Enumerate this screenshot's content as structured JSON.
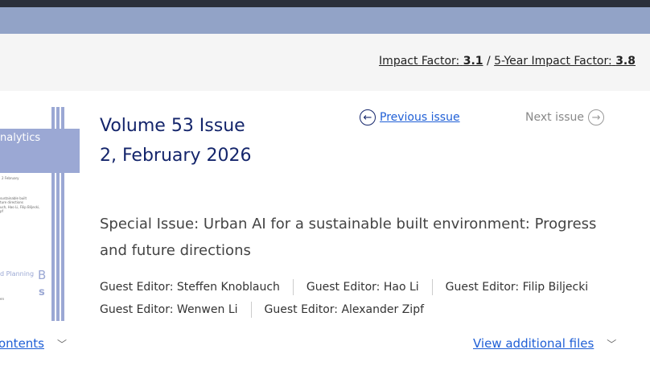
{
  "header": {
    "impact_factor_label": "Impact Factor:",
    "impact_factor": "3.1",
    "separator": "/",
    "five_year_label": "5-Year Impact Factor:",
    "five_year": "3.8"
  },
  "cover": {
    "journal_fragment": "nalytics",
    "date_fragment": "2  February",
    "text1": "sustainable built",
    "text2": "ture directions",
    "text3": "uch, Hao Li, Filip Biljecki,",
    "text4": "pf",
    "planning": "d  Planning",
    "letter_b": "B",
    "letter_s": "s",
    "small": "en",
    "accent": "#9ba8d4"
  },
  "issue": {
    "title_line1": "Volume 53 Issue",
    "title_line2": "2, February 2026",
    "prev": "Previous issue",
    "next": "Next issue"
  },
  "special_issue": "Special Issue: Urban AI for a sustainable built environment: Progress and future directions",
  "editors": [
    "Guest Editor: Steffen Knoblauch",
    "Guest Editor: Hao Li",
    "Guest Editor: Filip Biljecki",
    "Guest Editor: Wenwen Li",
    "Guest Editor: Alexander Zipf"
  ],
  "footer": {
    "contents": "ontents",
    "additional_files": "View additional files"
  },
  "colors": {
    "link": "#1f5fd6",
    "title": "#14256b",
    "band": "#92a3c7"
  }
}
